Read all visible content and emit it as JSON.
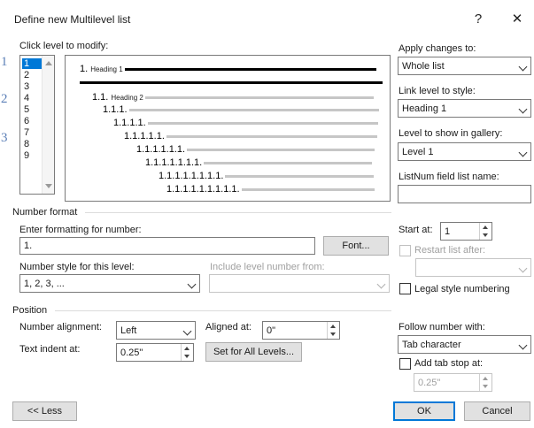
{
  "dialog": {
    "title": "Define new Multilevel list",
    "help_glyph": "?",
    "close_glyph": "✕"
  },
  "margin_numbers": [
    "1",
    "2",
    "3"
  ],
  "levels": {
    "label": "Click level to modify:",
    "items": [
      "1",
      "2",
      "3",
      "4",
      "5",
      "6",
      "7",
      "8",
      "9"
    ],
    "selected": "1"
  },
  "preview": {
    "rows": [
      {
        "num": "1.",
        "heading": "Heading 1"
      },
      {
        "num": "1.1.",
        "heading": "Heading 2"
      },
      {
        "num": "1.1.1.",
        "heading": ""
      },
      {
        "num": "1.1.1.1.",
        "heading": ""
      },
      {
        "num": "1.1.1.1.1.",
        "heading": ""
      },
      {
        "num": "1.1.1.1.1.1.",
        "heading": ""
      },
      {
        "num": "1.1.1.1.1.1.1.",
        "heading": ""
      },
      {
        "num": "1.1.1.1.1.1.1.1.",
        "heading": ""
      },
      {
        "num": "1.1.1.1.1.1.1.1.1.",
        "heading": ""
      }
    ]
  },
  "apply_changes": {
    "label": "Apply changes to:",
    "value": "Whole list"
  },
  "link_level": {
    "label": "Link level to style:",
    "value": "Heading 1"
  },
  "gallery_level": {
    "label": "Level to show in gallery:",
    "value": "Level 1"
  },
  "listnum": {
    "label": "ListNum field list name:",
    "value": ""
  },
  "number_format": {
    "section": "Number format",
    "enter_label": "Enter formatting for number:",
    "value": "1.",
    "font_button": "Font...",
    "style_label": "Number style for this level:",
    "style_value": "1, 2, 3, ...",
    "include_label": "Include level number from:",
    "include_value": ""
  },
  "start_at": {
    "label": "Start at:",
    "value": "1"
  },
  "restart": {
    "label": "Restart list after:",
    "value": ""
  },
  "legal": {
    "label": "Legal style numbering"
  },
  "position": {
    "section": "Position",
    "alignment_label": "Number alignment:",
    "alignment_value": "Left",
    "aligned_at_label": "Aligned at:",
    "aligned_at_value": "0\"",
    "indent_label": "Text indent at:",
    "indent_value": "0.25\"",
    "set_all_button": "Set for All Levels..."
  },
  "follow": {
    "label": "Follow number with:",
    "value": "Tab character"
  },
  "tab_stop": {
    "label": "Add tab stop at:",
    "value": "0.25\""
  },
  "footer": {
    "less_button": "<< Less",
    "ok_button": "OK",
    "cancel_button": "Cancel"
  },
  "colors": {
    "accent": "#0078d7",
    "margin_number": "#5b7fb7"
  }
}
